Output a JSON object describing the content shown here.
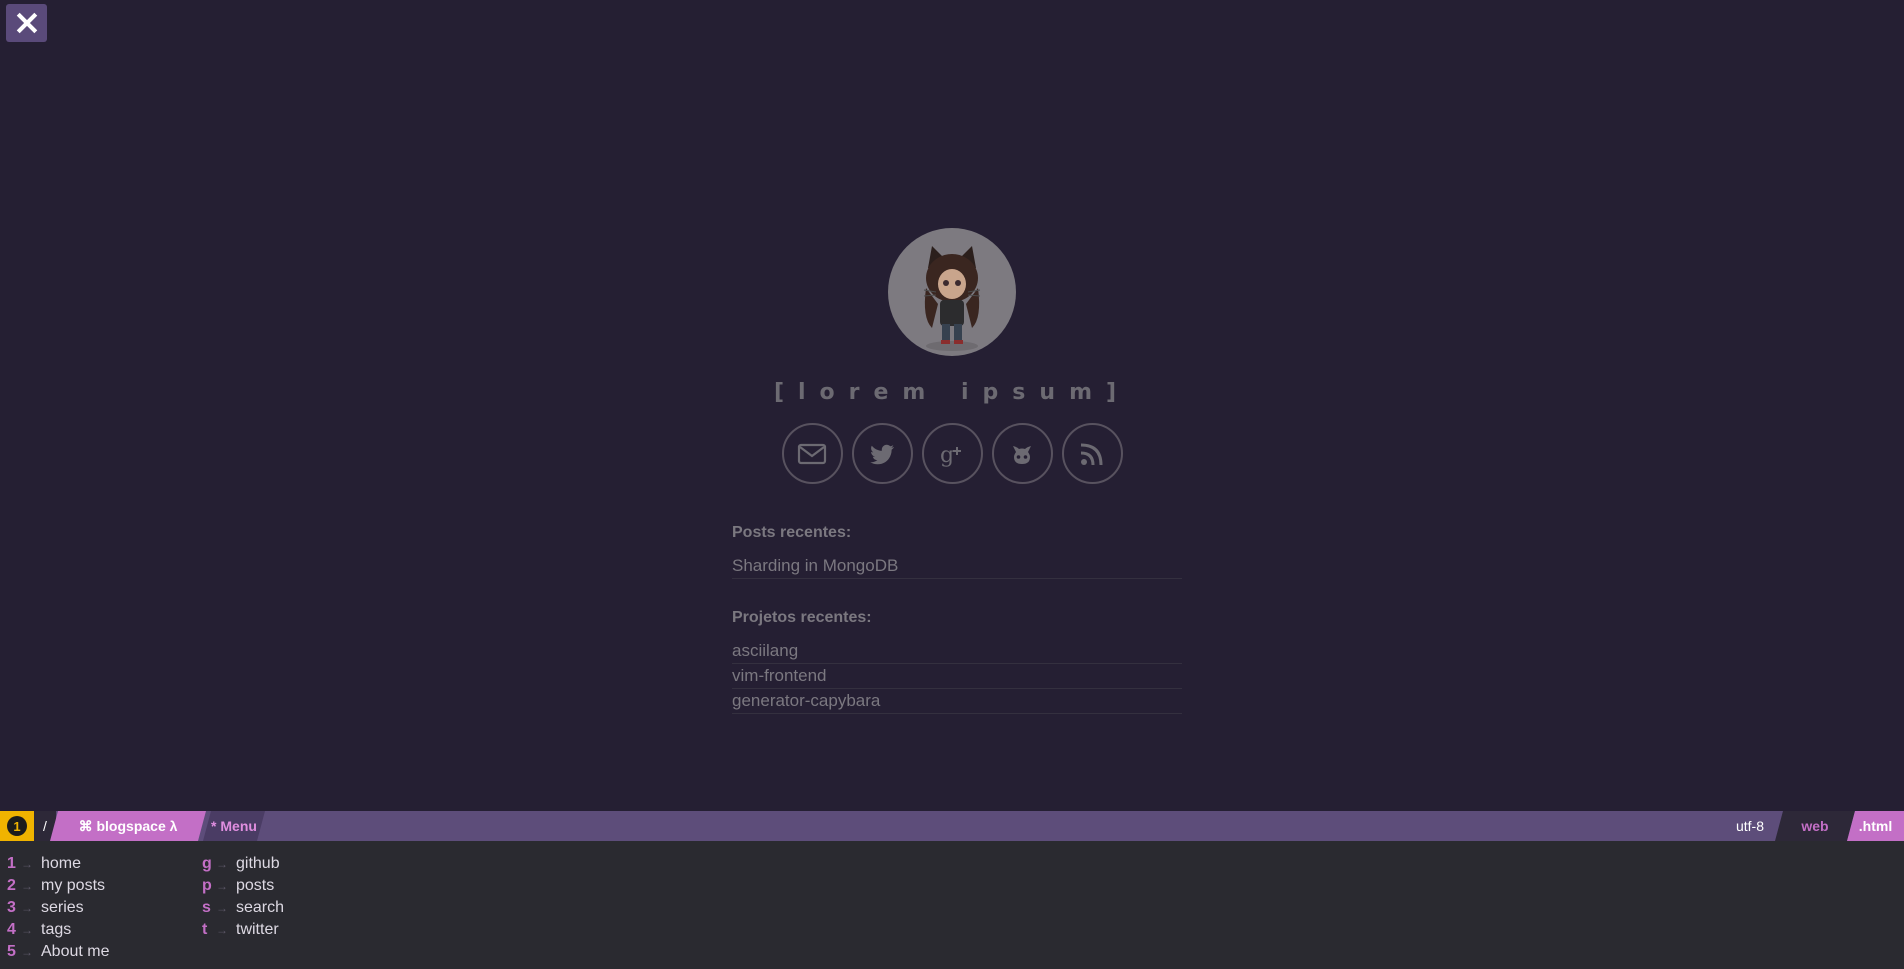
{
  "close_button": {
    "icon": "close-icon"
  },
  "profile": {
    "avatar_alt": "octocat avatar",
    "title": "[lorem ipsum]",
    "socials": [
      {
        "name": "email",
        "icon": "envelope-icon"
      },
      {
        "name": "twitter",
        "icon": "twitter-icon"
      },
      {
        "name": "google-plus",
        "icon": "google-plus-icon"
      },
      {
        "name": "github",
        "icon": "github-icon"
      },
      {
        "name": "rss",
        "icon": "rss-icon"
      }
    ]
  },
  "posts": {
    "heading": "Posts recentes:",
    "items": [
      "Sharding in MongoDB"
    ]
  },
  "projects": {
    "heading": "Projetos recentes:",
    "items": [
      "asciilang",
      "vim-frontend",
      "generator-capybara"
    ]
  },
  "statusbar": {
    "buffer_number": "1",
    "separator": "/",
    "blog_label": "⌘ blogspace λ",
    "menu_label": "* Menu",
    "encoding": "utf-8",
    "filetype": "web",
    "extension": ".html"
  },
  "menu": {
    "left": [
      {
        "key": "1",
        "label": "home"
      },
      {
        "key": "2",
        "label": "my posts"
      },
      {
        "key": "3",
        "label": "series"
      },
      {
        "key": "4",
        "label": "tags"
      },
      {
        "key": "5",
        "label": "About me"
      }
    ],
    "right": [
      {
        "key": "g",
        "label": "github"
      },
      {
        "key": "p",
        "label": "posts"
      },
      {
        "key": "s",
        "label": "search"
      },
      {
        "key": "t",
        "label": "twitter"
      }
    ]
  },
  "colors": {
    "background": "#251f33",
    "statusbar": "#5d4d7a",
    "accent": "#c36fc6",
    "highlight": "#f0b300"
  }
}
